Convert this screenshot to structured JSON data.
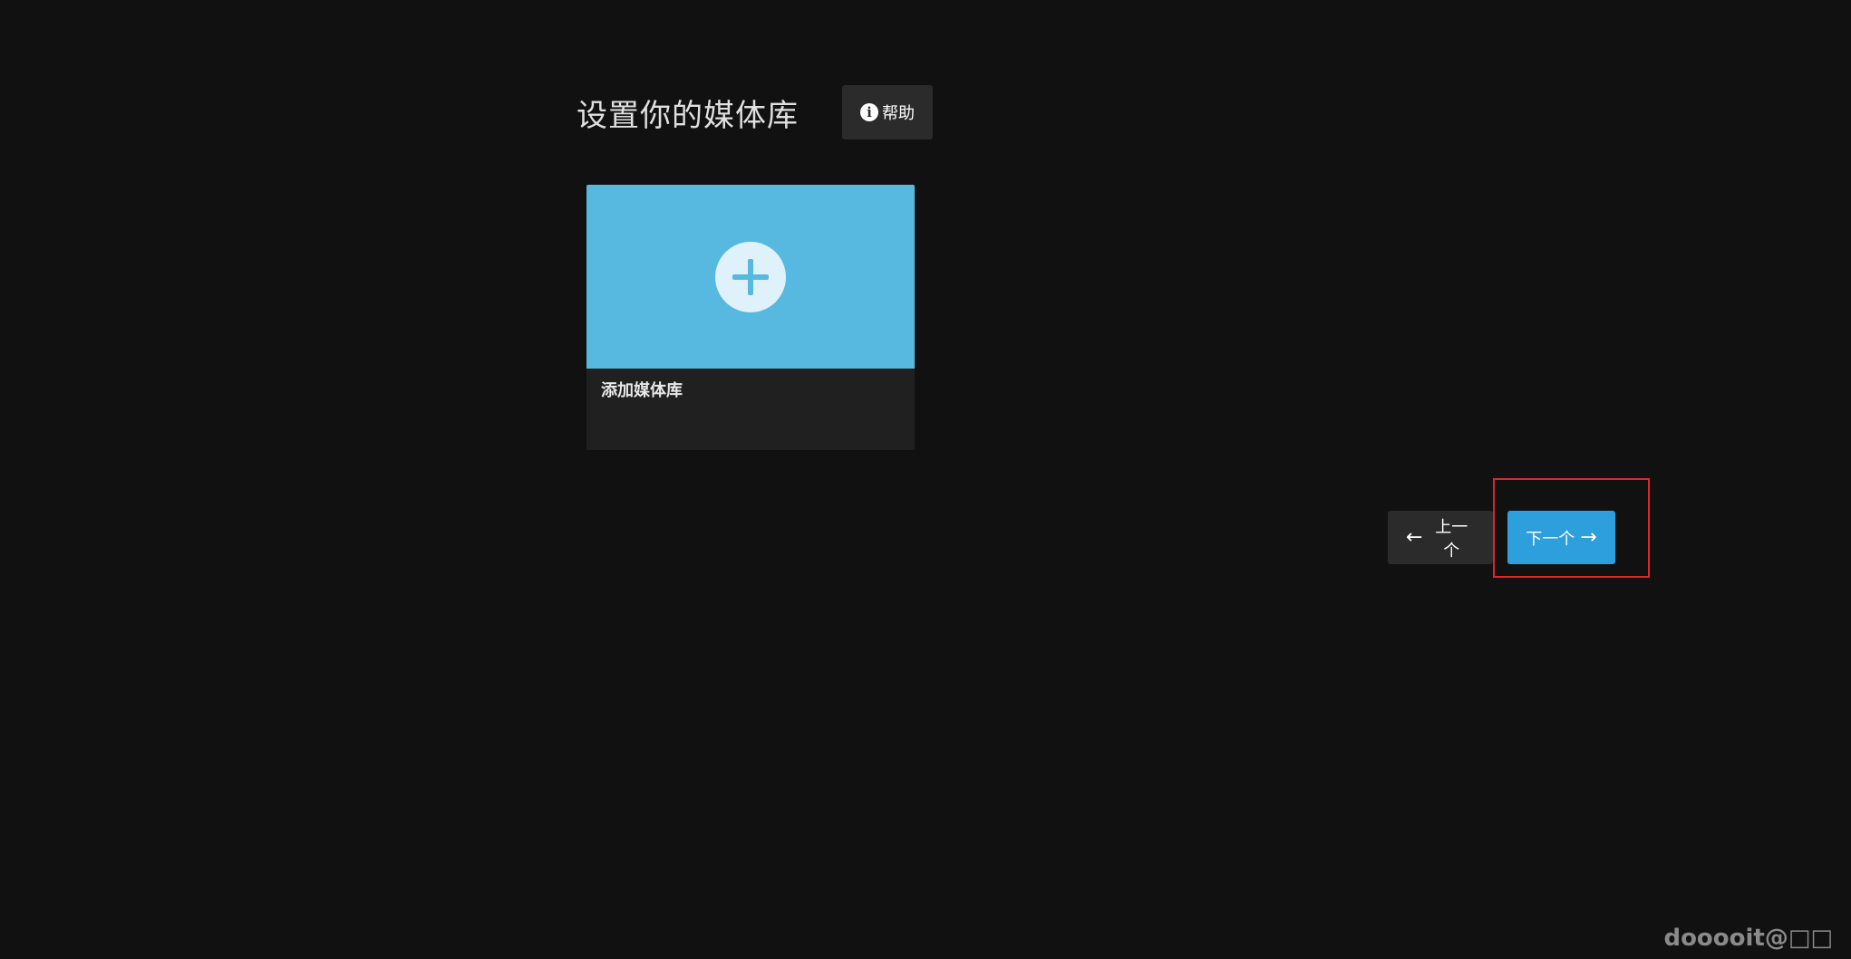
{
  "header": {
    "title": "设置你的媒体库",
    "help_label": "帮助",
    "help_icon": "info-icon"
  },
  "library_card": {
    "label": "添加媒体库",
    "icon": "plus-icon",
    "accent_color": "#57b9e0"
  },
  "navigation": {
    "prev_label": "上一个",
    "next_label": "下一个",
    "prev_icon": "arrow-left-icon",
    "next_icon": "arrow-right-icon",
    "next_color": "#2d9fdd"
  },
  "highlight": {
    "color": "#e3242b"
  },
  "watermark": {
    "text": "dooooit@□□"
  }
}
